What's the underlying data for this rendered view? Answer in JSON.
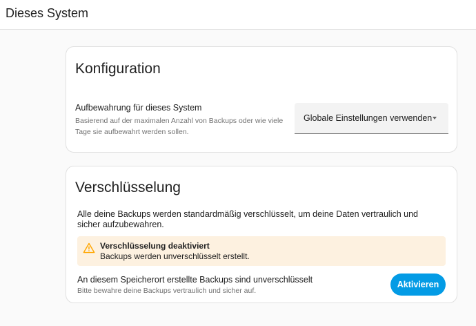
{
  "header": {
    "title": "Dieses System"
  },
  "config_card": {
    "title": "Konfiguration",
    "retention_label": "Aufbewahrung für dieses System",
    "retention_desc": "Basierend auf der maximalen Anzahl von Backups oder wie viele Tage sie aufbewahrt werden sollen.",
    "retention_select_value": "Globale Einstellungen verwenden"
  },
  "encryption_card": {
    "title": "Verschlüsselung",
    "description": "Alle deine Backups werden standardmäßig verschlüsselt, um deine Daten vertraulich und sicher aufzubewahren.",
    "alert": {
      "title": "Verschlüsselung deaktiviert",
      "text": "Backups werden unverschlüsselt erstellt."
    },
    "unencrypted_label": "An diesem Speicherort erstellte Backups sind unverschlüsselt",
    "unencrypted_sub": "Bitte bewahre deine Backups vertraulich und sicher auf.",
    "activate_button": "Aktivieren"
  },
  "icons": {
    "alert": "warning-icon",
    "select": "chevron-down-icon"
  },
  "colors": {
    "primary": "#039be5",
    "warning": "#ffa600",
    "warning_bg": "#fdf1e0"
  }
}
